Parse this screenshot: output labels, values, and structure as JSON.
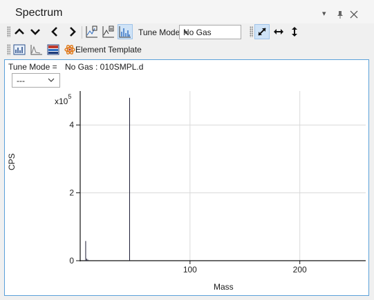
{
  "window": {
    "title": "Spectrum",
    "menu_glyph": "▾",
    "pin_glyph": "📌",
    "close_glyph": "✕"
  },
  "toolbar1": {
    "tune_mode_label": "Tune Mode:",
    "tune_mode_value": "No Gas",
    "buttons": [
      "up-arrow",
      "down-arrow",
      "prev-arrow",
      "next-arrow",
      "spectrum-overlay",
      "spectrum-copy",
      "spectrum-bars",
      "fit-both",
      "fit-horizontal",
      "fit-vertical"
    ]
  },
  "toolbar2": {
    "element_template_label": "Element Template",
    "buttons": [
      "bar-spectrum",
      "profile-spectrum",
      "periodic-table",
      "element-template"
    ]
  },
  "panel": {
    "tune_mode_text": "Tune Mode =",
    "file_text": "No Gas : 010SMPL.d",
    "selector_value": "---"
  },
  "chart_data": {
    "type": "bar",
    "title": "",
    "xlabel": "Mass",
    "ylabel": "CPS",
    "y_multiplier_label": "x10",
    "y_multiplier_exp": "5",
    "xlim": [
      0,
      260
    ],
    "ylim": [
      0,
      5
    ],
    "x_ticks": [
      100,
      200
    ],
    "y_ticks": [
      0,
      2,
      4
    ],
    "grid": true,
    "series": [
      {
        "points": [
          {
            "x": 5,
            "y": 0.58
          },
          {
            "x": 6,
            "y": 0.06
          },
          {
            "x": 7,
            "y": 0.03
          },
          {
            "x": 45,
            "y": 4.8
          }
        ]
      }
    ]
  }
}
